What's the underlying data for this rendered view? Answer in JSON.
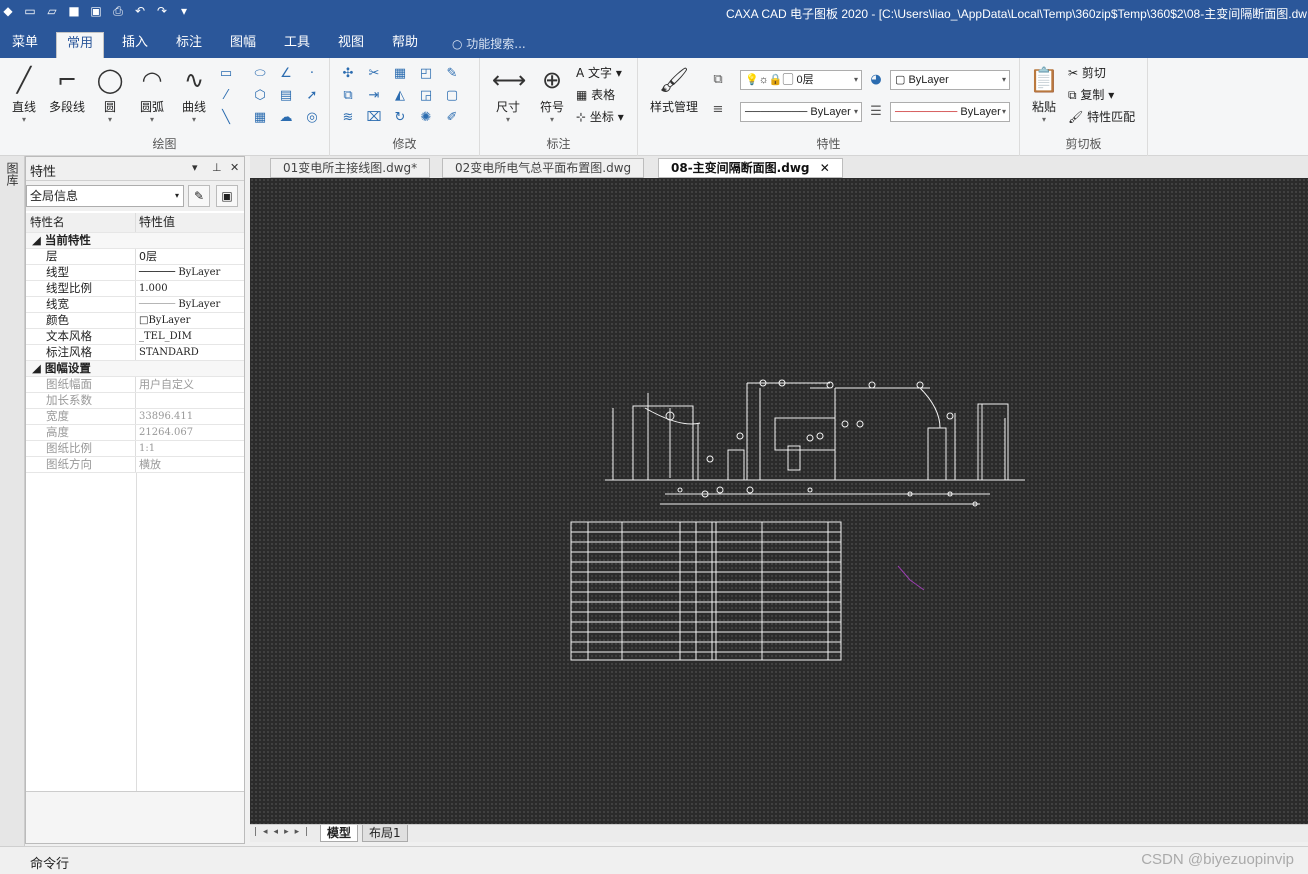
{
  "window": {
    "title": "CAXA CAD 电子图板 2020 - [C:\\Users\\liao_\\AppData\\Local\\Temp\\360zip$Temp\\360$2\\08-主变间隔断面图.dw"
  },
  "menu": {
    "items": [
      "菜单",
      "常用",
      "插入",
      "标注",
      "图幅",
      "工具",
      "视图",
      "帮助"
    ],
    "active": "常用",
    "search_placeholder": "功能搜索..."
  },
  "ribbon": {
    "draw": {
      "label": "绘图",
      "buttons": [
        "直线",
        "多段线",
        "圆",
        "圆弧",
        "曲线"
      ]
    },
    "modify": {
      "label": "修改"
    },
    "annotate": {
      "label": "标注",
      "buttons": [
        "尺寸",
        "符号"
      ],
      "small": [
        "文字",
        "表格",
        "坐标"
      ]
    },
    "style": {
      "button": "样式管理"
    },
    "properties": {
      "label": "特性",
      "layer": "0层",
      "color": "ByLayer",
      "linetype": "ByLayer",
      "lineweight": "ByLayer"
    },
    "clipboard": {
      "label": "剪切板",
      "paste": "粘贴",
      "cut": "剪切",
      "copy": "复制",
      "match": "特性匹配"
    }
  },
  "sidebar": {
    "tab": "图库"
  },
  "properties_panel": {
    "title": "特性",
    "scope": "全局信息",
    "col_name": "特性名",
    "col_value": "特性值",
    "sections": [
      {
        "name": "当前特性",
        "rows": [
          {
            "k": "层",
            "v": "0层"
          },
          {
            "k": "线型",
            "v": "ByLayer"
          },
          {
            "k": "线型比例",
            "v": "1.000"
          },
          {
            "k": "线宽",
            "v": "ByLayer"
          },
          {
            "k": "颜色",
            "v": "ByLayer"
          },
          {
            "k": "文本风格",
            "v": "_TEL_DIM"
          },
          {
            "k": "标注风格",
            "v": "STANDARD"
          }
        ]
      },
      {
        "name": "图幅设置",
        "rows": [
          {
            "k": "图纸幅面",
            "v": "用户自定义"
          },
          {
            "k": "加长系数",
            "v": ""
          },
          {
            "k": "宽度",
            "v": "33896.411"
          },
          {
            "k": "高度",
            "v": "21264.067"
          },
          {
            "k": "图纸比例",
            "v": "1:1"
          },
          {
            "k": "图纸方向",
            "v": "横放"
          }
        ]
      }
    ]
  },
  "doc_tabs": [
    "01变电所主接线图.dwg*",
    "02变电所电气总平面布置图.dwg",
    "08-主变间隔断面图.dwg"
  ],
  "layout_tabs": [
    "模型",
    "布局1"
  ],
  "command": {
    "label": "命令行"
  },
  "watermark": "CSDN @biyezuopinvip"
}
